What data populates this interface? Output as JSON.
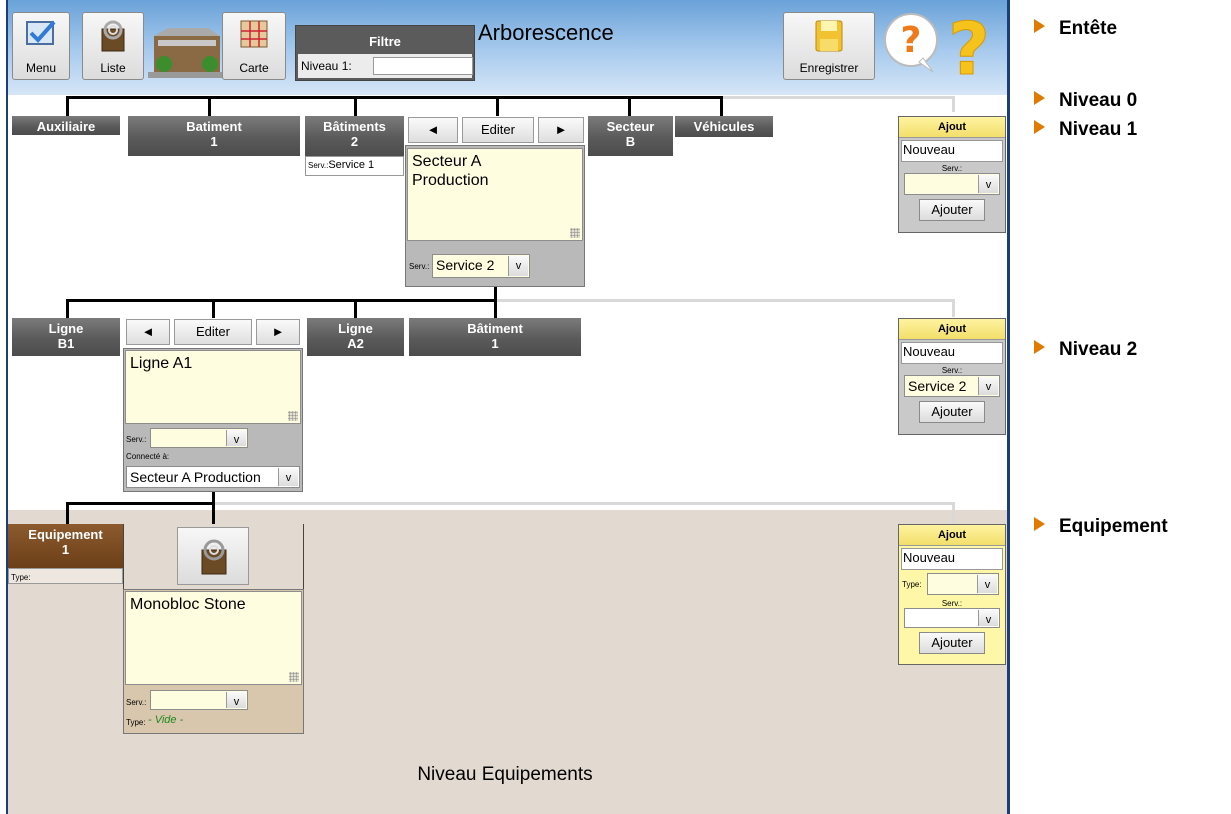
{
  "header": {
    "menu_label": "Menu",
    "liste_label": "Liste",
    "carte_label": "Carte",
    "filtre_title": "Filtre",
    "niveau1_label": "Niveau 1:",
    "title": "Arborescence",
    "save_label": "Enregistrer"
  },
  "level0": {
    "nodes": [
      "Auxiliaire",
      "Batiment\n1",
      "Bâtiments\n2",
      "Secteur\nB",
      "Véhicules"
    ],
    "batiments2_service": "Service 1",
    "batiments2_serv_label": "Serv.:",
    "nav_prev": "◄",
    "nav_edit": "Editer",
    "nav_next": "►",
    "selected_text": "Secteur A\nProduction",
    "serv_label": "Serv.:",
    "serv_value": "Service 2"
  },
  "level1": {
    "nodes": [
      "Ligne\nB1",
      "Ligne\nA2",
      "Bâtiment\n1"
    ],
    "nav_prev": "◄",
    "nav_edit": "Editer",
    "nav_next": "►",
    "selected_text": "Ligne A1",
    "serv_label": "Serv.:",
    "connect_label": "Connecté à:",
    "connect_value": "Secteur A Production"
  },
  "level2": {
    "node": "Equipement\n1",
    "type_label": "Type:",
    "selected_text": "Monobloc Stone",
    "serv_label": "Serv.:",
    "type_value_label": "Type:",
    "type_value": "- Vide -",
    "area_label": "Niveau Equipements"
  },
  "ajout_panels": [
    {
      "title": "Ajout",
      "nouveau": "Nouveau",
      "serv_label": "Serv.:",
      "serv_value": "",
      "button": "Ajouter"
    },
    {
      "title": "Ajout",
      "nouveau": "Nouveau",
      "serv_label": "Serv.:",
      "serv_value": "Service 2",
      "button": "Ajouter"
    },
    {
      "title": "Ajout",
      "nouveau": "Nouveau",
      "type_label": "Type:",
      "serv_label": "Serv.:",
      "button": "Ajouter"
    }
  ],
  "annotations": [
    "Entête",
    "Niveau 0",
    "Niveau 1",
    "Niveau 2",
    "Equipement"
  ],
  "icons": {
    "chevron": "v",
    "menu": "checkmark-icon",
    "liste": "ring-binder-icon",
    "carte": "map-icon",
    "save": "floppy-disk-icon",
    "help": "question-mark-icon"
  },
  "colors": {
    "header_top": "#6aa2d8",
    "node_gray": "#5a5a5a",
    "node_brown": "#6c3f18",
    "note_yellow": "#fffde0",
    "equip_bg": "#e2d9d1",
    "accent_orange": "#e07a00"
  }
}
